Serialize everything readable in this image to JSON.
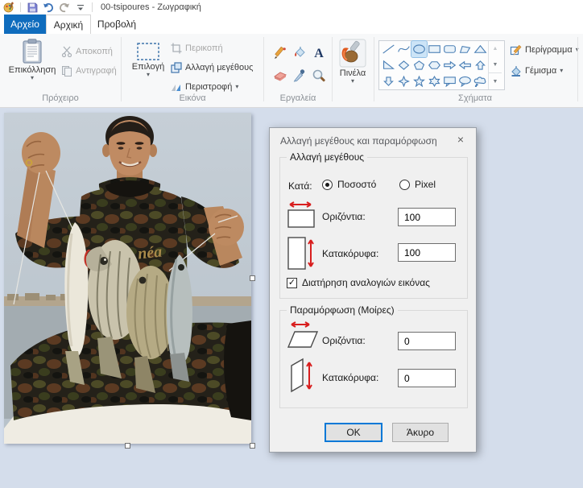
{
  "window": {
    "title": "00-tsipoures - Ζωγραφική"
  },
  "icons": {
    "dropdown": "▾",
    "close": "×",
    "check": "✓",
    "scroll_up": "▲",
    "scroll_down": "▼",
    "scroll_more": "▼"
  },
  "tabs": {
    "file": "Αρχείο",
    "home": "Αρχική",
    "view": "Προβολή"
  },
  "ribbon": {
    "clipboard": {
      "group_label": "Πρόχειρο",
      "paste": "Επικόλληση",
      "cut": "Αποκοπή",
      "copy": "Αντιγραφή"
    },
    "image": {
      "group_label": "Εικόνα",
      "select": "Επιλογή",
      "crop": "Περικοπή",
      "resize": "Αλλαγή μεγέθους",
      "rotate": "Περιστροφή"
    },
    "tools": {
      "group_label": "Εργαλεία",
      "items": [
        "pencil",
        "fill-bucket",
        "text",
        "eraser",
        "color-picker",
        "magnifier"
      ]
    },
    "brushes": {
      "label": "Πινέλα"
    },
    "shapes": {
      "group_label": "Σχήματα",
      "outline": "Περίγραμμα",
      "fill": "Γέμισμα",
      "selected": "ellipse",
      "items": [
        "line",
        "curve",
        "ellipse",
        "rectangle",
        "rounded-rectangle",
        "polygon",
        "triangle",
        "right-triangle",
        "diamond",
        "pentagon",
        "hexagon",
        "arrow-right",
        "arrow-left",
        "arrow-up",
        "arrow-down",
        "star-4",
        "star-5",
        "star-6",
        "callout-rectangle",
        "callout-oval",
        "callout-cloud"
      ]
    }
  },
  "canvas": {
    "photo_brand_text": "néa"
  },
  "dialog": {
    "title": "Αλλαγή μεγέθους και παραμόρφωση",
    "resize": {
      "group_label": "Αλλαγή μεγέθους",
      "by_label": "Κατά:",
      "percent_label": "Ποσοστό",
      "pixel_label": "Pixel",
      "selected_unit": "Ποσοστό",
      "horizontal_label": "Οριζόντια:",
      "horizontal_value": "100",
      "vertical_label": "Κατακόρυφα:",
      "vertical_value": "100",
      "keep_aspect_label": "Διατήρηση αναλογιών εικόνας",
      "keep_aspect_checked": true
    },
    "skew": {
      "group_label": "Παραμόρφωση (Μοίρες)",
      "horizontal_label": "Οριζόντια:",
      "horizontal_value": "0",
      "vertical_label": "Κατακόρυφα:",
      "vertical_value": "0"
    },
    "ok_label": "OK",
    "cancel_label": "Άκυρο"
  },
  "colors": {
    "file_tab_blue": "#0f6cbd",
    "canvas_background": "#d4ddeb",
    "dialog_accent_red": "#d81e1e",
    "shape_stroke_blue": "#4a7fb5",
    "selected_shape_background": "#cce4f7",
    "default_button_border": "#0078d7"
  }
}
